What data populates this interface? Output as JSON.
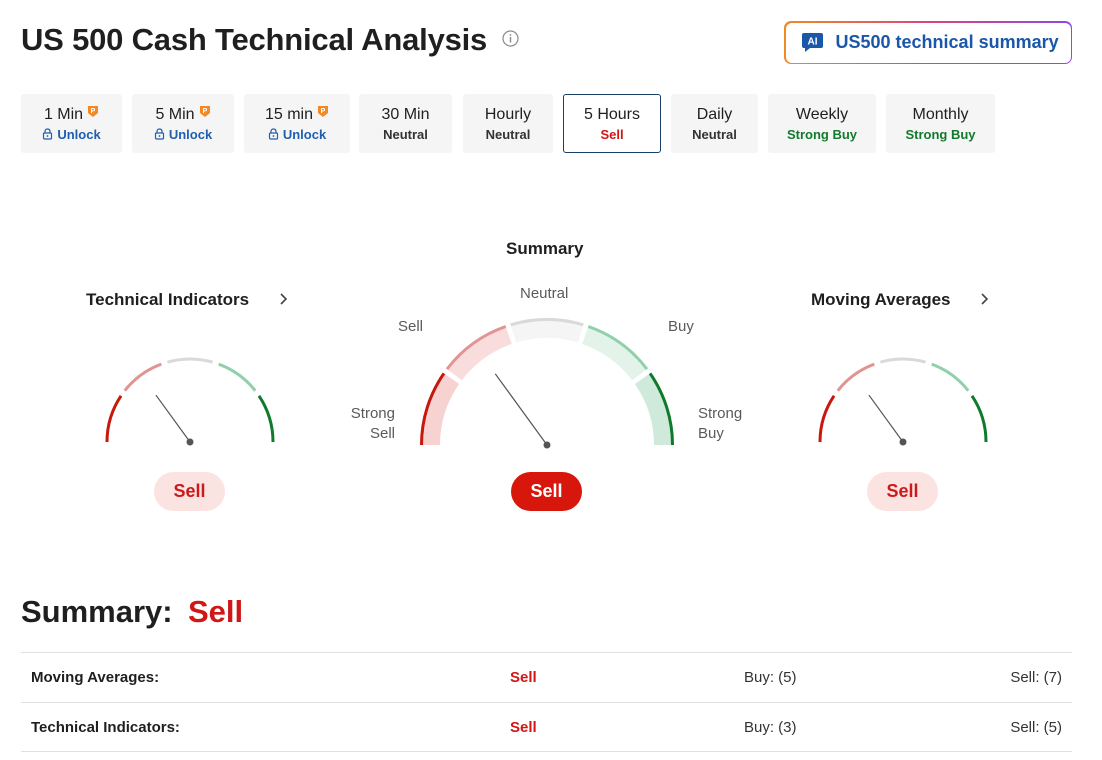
{
  "header": {
    "title": "US 500 Cash Technical Analysis",
    "ai_button": {
      "badge": "AI",
      "label": "US500 technical summary"
    }
  },
  "timeframes": [
    {
      "name": "1 Min",
      "status": "Unlock",
      "tone": "unlock",
      "pro": true,
      "locked": true
    },
    {
      "name": "5 Min",
      "status": "Unlock",
      "tone": "unlock",
      "pro": true,
      "locked": true
    },
    {
      "name": "15 min",
      "status": "Unlock",
      "tone": "unlock",
      "pro": true,
      "locked": true
    },
    {
      "name": "30 Min",
      "status": "Neutral",
      "tone": "neutral",
      "pro": false,
      "locked": false
    },
    {
      "name": "Hourly",
      "status": "Neutral",
      "tone": "neutral",
      "pro": false,
      "locked": false
    },
    {
      "name": "5 Hours",
      "status": "Sell",
      "tone": "sell",
      "pro": false,
      "locked": false,
      "active": true
    },
    {
      "name": "Daily",
      "status": "Neutral",
      "tone": "neutral",
      "pro": false,
      "locked": false
    },
    {
      "name": "Weekly",
      "status": "Strong Buy",
      "tone": "buy",
      "pro": false,
      "locked": false
    },
    {
      "name": "Monthly",
      "status": "Strong Buy",
      "tone": "buy",
      "pro": false,
      "locked": false
    }
  ],
  "gauges": {
    "technical_indicators": {
      "title": "Technical Indicators",
      "verdict": "Sell"
    },
    "summary": {
      "title": "Summary",
      "verdict": "Sell",
      "labels": {
        "neutral": "Neutral",
        "sell": "Sell",
        "buy": "Buy",
        "strong_sell": "Strong\nSell",
        "strong_buy": "Strong\nBuy"
      }
    },
    "moving_averages": {
      "title": "Moving Averages",
      "verdict": "Sell"
    }
  },
  "summary": {
    "heading": "Summary:",
    "value": "Sell",
    "rows": [
      {
        "label": "Moving Averages:",
        "verdict": "Sell",
        "buy": "Buy: (5)",
        "sell": "Sell: (7)"
      },
      {
        "label": "Technical Indicators:",
        "verdict": "Sell",
        "buy": "Buy: (3)",
        "sell": "Sell: (5)"
      }
    ]
  },
  "colors": {
    "strong_sell": "#c8170d",
    "sell": "#e09593",
    "neutral": "#d9d9d9",
    "buy": "#91d0aa",
    "strong_buy": "#0f7a2b",
    "needle": "#555555"
  }
}
